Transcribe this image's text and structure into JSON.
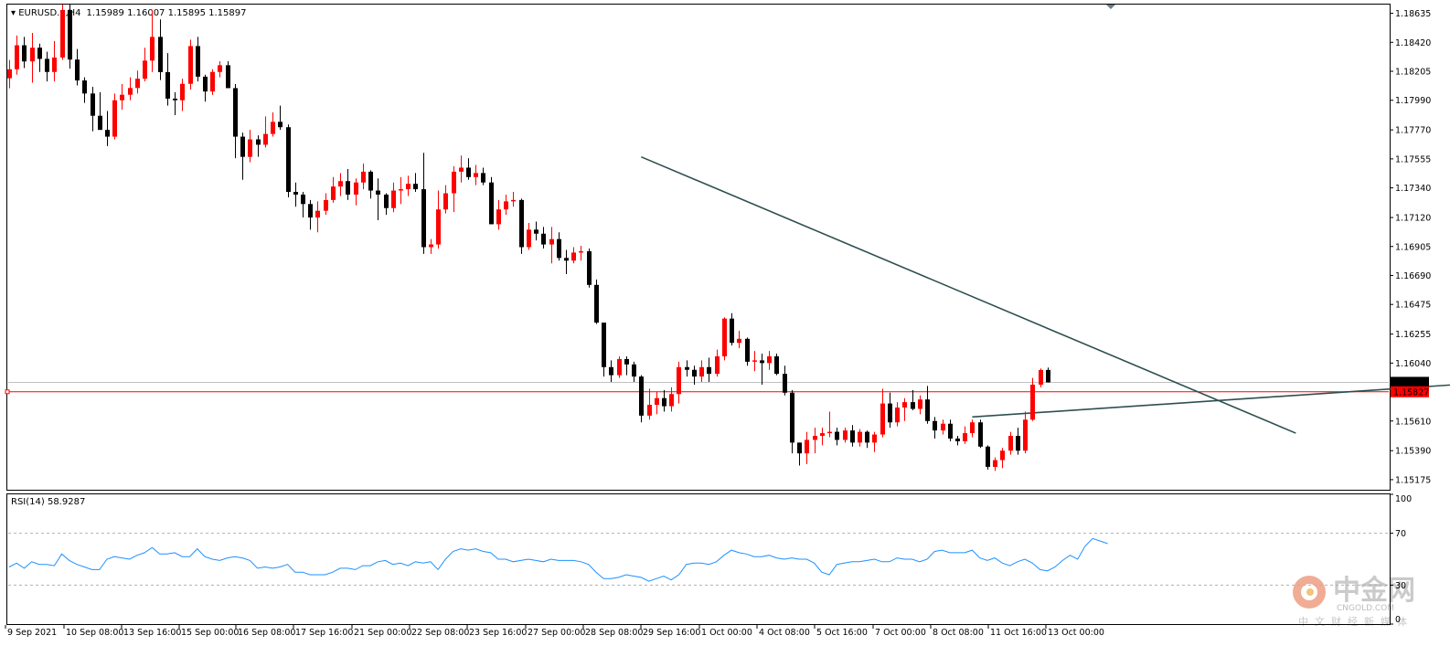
{
  "symbol_info": {
    "symbol": "EURUSD.a,H4",
    "ohlc": "1.15989 1.16007 1.15895 1.15897"
  },
  "price_axis": {
    "ticks": [
      "1.18635",
      "1.18420",
      "1.18205",
      "1.17990",
      "1.17770",
      "1.17555",
      "1.17340",
      "1.17120",
      "1.16905",
      "1.16690",
      "1.16475",
      "1.16255",
      "1.16040",
      "1.15610",
      "1.15390",
      "1.15175"
    ],
    "bid_label": "1.15897",
    "line_label": "1.15827"
  },
  "rsi_panel": {
    "label": "RSI(14) 58.9287",
    "levels": [
      "100",
      "70",
      "30",
      "0"
    ]
  },
  "time_axis": {
    "labels": [
      "9 Sep 2021",
      "10 Sep 08:00",
      "13 Sep 16:00",
      "15 Sep 00:00",
      "16 Sep 08:00",
      "17 Sep 16:00",
      "21 Sep 00:00",
      "22 Sep 08:00",
      "23 Sep 16:00",
      "27 Sep 00:00",
      "28 Sep 08:00",
      "29 Sep 16:00",
      "1 Oct 00:00",
      "4 Oct 08:00",
      "5 Oct 16:00",
      "7 Oct 00:00",
      "8 Oct 08:00",
      "11 Oct 16:00",
      "13 Oct 00:00"
    ]
  },
  "watermark": {
    "brand": "中金网",
    "domain": "CNGOLD.COM",
    "slogan": "中文财经新媒体"
  },
  "colors": {
    "bull": "#ff0000",
    "bear": "#000000",
    "rsi_line": "#1e90ff",
    "horizontal_line": "#ff0000",
    "trendline": "#2f4f4f",
    "bid_line": "#c0c0c0"
  },
  "chart_data": [
    {
      "type": "candlestick",
      "symbol": "EURUSD.a",
      "timeframe": "H4",
      "ylim": [
        1.151,
        1.187
      ],
      "horizontal_line": 1.15827,
      "bid": 1.15897,
      "trendlines": [
        {
          "from": [
            1.1757,
            84
          ],
          "to": [
            1.1552,
            171
          ]
        },
        {
          "from": [
            1.1564,
            128
          ],
          "to": [
            1.1592,
            203
          ]
        }
      ],
      "ohlc": [
        [
          1.18153,
          1.18289,
          1.18079,
          1.1822
        ],
        [
          1.1822,
          1.1847,
          1.1818,
          1.18398
        ],
        [
          1.18398,
          1.1846,
          1.18229,
          1.18278
        ],
        [
          1.18278,
          1.1849,
          1.1812,
          1.1838
        ],
        [
          1.1838,
          1.1841,
          1.182,
          1.18297
        ],
        [
          1.18297,
          1.1835,
          1.1813,
          1.182
        ],
        [
          1.182,
          1.1843,
          1.1813,
          1.18307
        ],
        [
          1.18307,
          1.187,
          1.1829,
          1.1866
        ],
        [
          1.1866,
          1.187,
          1.18225,
          1.18292
        ],
        [
          1.18292,
          1.1837,
          1.181,
          1.18137
        ],
        [
          1.18137,
          1.1816,
          1.1797,
          1.1804
        ],
        [
          1.1804,
          1.1809,
          1.1776,
          1.17875
        ],
        [
          1.17875,
          1.1805,
          1.1778,
          1.1777
        ],
        [
          1.1777,
          1.1791,
          1.1765,
          1.1772
        ],
        [
          1.1772,
          1.1804,
          1.177,
          1.1799
        ],
        [
          1.1799,
          1.1811,
          1.1792,
          1.18031
        ],
        [
          1.18031,
          1.1816,
          1.1799,
          1.18081
        ],
        [
          1.18081,
          1.1821,
          1.1804,
          1.1815
        ],
        [
          1.1815,
          1.1838,
          1.1813,
          1.18284
        ],
        [
          1.18284,
          1.1866,
          1.182,
          1.1846
        ],
        [
          1.1846,
          1.1859,
          1.1814,
          1.18199
        ],
        [
          1.18199,
          1.1834,
          1.1795,
          1.18002
        ],
        [
          1.18002,
          1.1805,
          1.1788,
          1.1799
        ],
        [
          1.1799,
          1.1815,
          1.1791,
          1.18112
        ],
        [
          1.18112,
          1.1844,
          1.1807,
          1.18392
        ],
        [
          1.18392,
          1.1846,
          1.1813,
          1.18165
        ],
        [
          1.18165,
          1.1818,
          1.1798,
          1.18055
        ],
        [
          1.18055,
          1.1822,
          1.1803,
          1.182
        ],
        [
          1.182,
          1.1828,
          1.1816,
          1.1825
        ],
        [
          1.1825,
          1.1828,
          1.1808,
          1.1808
        ],
        [
          1.1808,
          1.1811,
          1.1756,
          1.1772
        ],
        [
          1.1772,
          1.1775,
          1.174,
          1.1757
        ],
        [
          1.1757,
          1.1777,
          1.1753,
          1.177
        ],
        [
          1.177,
          1.1773,
          1.1757,
          1.1766
        ],
        [
          1.1766,
          1.1787,
          1.1764,
          1.1774
        ],
        [
          1.1774,
          1.179,
          1.1772,
          1.1783
        ],
        [
          1.1783,
          1.1795,
          1.1777,
          1.1779
        ],
        [
          1.1779,
          1.1781,
          1.1727,
          1.1731
        ],
        [
          1.1731,
          1.1738,
          1.172,
          1.1729
        ],
        [
          1.1729,
          1.1731,
          1.1712,
          1.1722
        ],
        [
          1.1722,
          1.1725,
          1.1703,
          1.1712
        ],
        [
          1.1712,
          1.1724,
          1.1701,
          1.1717
        ],
        [
          1.1717,
          1.173,
          1.1714,
          1.1725
        ],
        [
          1.1725,
          1.1742,
          1.1723,
          1.1735
        ],
        [
          1.1735,
          1.1745,
          1.1728,
          1.1739
        ],
        [
          1.1739,
          1.1748,
          1.1725,
          1.1729
        ],
        [
          1.1729,
          1.1741,
          1.1721,
          1.1738
        ],
        [
          1.1738,
          1.1752,
          1.1733,
          1.1746
        ],
        [
          1.1746,
          1.1747,
          1.1726,
          1.1732
        ],
        [
          1.1732,
          1.1741,
          1.171,
          1.1729
        ],
        [
          1.1729,
          1.173,
          1.1714,
          1.1719
        ],
        [
          1.1719,
          1.1738,
          1.1716,
          1.1732
        ],
        [
          1.1732,
          1.1742,
          1.1722,
          1.1733
        ],
        [
          1.1733,
          1.1743,
          1.1728,
          1.1737
        ],
        [
          1.1737,
          1.1745,
          1.1731,
          1.1733
        ],
        [
          1.1733,
          1.176,
          1.1685,
          1.169
        ],
        [
          1.169,
          1.1696,
          1.1685,
          1.1692
        ],
        [
          1.1692,
          1.1732,
          1.1689,
          1.1718
        ],
        [
          1.1718,
          1.1736,
          1.1715,
          1.173
        ],
        [
          1.173,
          1.175,
          1.1716,
          1.1746
        ],
        [
          1.1746,
          1.1758,
          1.1738,
          1.1749
        ],
        [
          1.1749,
          1.1756,
          1.174,
          1.1742
        ],
        [
          1.1742,
          1.1751,
          1.1736,
          1.1745
        ],
        [
          1.1745,
          1.1749,
          1.1736,
          1.1738
        ],
        [
          1.1738,
          1.1742,
          1.1707,
          1.1707
        ],
        [
          1.1707,
          1.1725,
          1.1703,
          1.1718
        ],
        [
          1.1718,
          1.1729,
          1.1714,
          1.1724
        ],
        [
          1.1724,
          1.1731,
          1.172,
          1.1725
        ],
        [
          1.1725,
          1.1726,
          1.1685,
          1.169
        ],
        [
          1.169,
          1.1708,
          1.1688,
          1.1703
        ],
        [
          1.1703,
          1.1709,
          1.1695,
          1.17
        ],
        [
          1.17,
          1.1705,
          1.1689,
          1.1692
        ],
        [
          1.1692,
          1.1705,
          1.1678,
          1.1696
        ],
        [
          1.1696,
          1.1701,
          1.168,
          1.1682
        ],
        [
          1.1682,
          1.1688,
          1.167,
          1.168
        ],
        [
          1.168,
          1.169,
          1.1678,
          1.1686
        ],
        [
          1.1686,
          1.1691,
          1.168,
          1.1687
        ],
        [
          1.1687,
          1.1689,
          1.166,
          1.1662
        ],
        [
          1.1662,
          1.1666,
          1.1633,
          1.1634
        ],
        [
          1.1634,
          1.1634,
          1.1594,
          1.1601
        ],
        [
          1.1601,
          1.1606,
          1.159,
          1.1595
        ],
        [
          1.1595,
          1.1609,
          1.1593,
          1.1607
        ],
        [
          1.1607,
          1.1609,
          1.1595,
          1.1603
        ],
        [
          1.1603,
          1.1605,
          1.159,
          1.1594
        ],
        [
          1.1594,
          1.1595,
          1.156,
          1.1565
        ],
        [
          1.1565,
          1.1585,
          1.1562,
          1.1573
        ],
        [
          1.1573,
          1.1583,
          1.1566,
          1.1578
        ],
        [
          1.1578,
          1.1584,
          1.1568,
          1.1572
        ],
        [
          1.1572,
          1.1586,
          1.1568,
          1.1581
        ],
        [
          1.1581,
          1.1605,
          1.1574,
          1.1601
        ],
        [
          1.1601,
          1.1606,
          1.1594,
          1.1599
        ],
        [
          1.1599,
          1.1602,
          1.1588,
          1.1594
        ],
        [
          1.1594,
          1.1606,
          1.159,
          1.1601
        ],
        [
          1.1601,
          1.1608,
          1.159,
          1.1596
        ],
        [
          1.1596,
          1.1614,
          1.1594,
          1.1609
        ],
        [
          1.1609,
          1.1638,
          1.1606,
          1.1637
        ],
        [
          1.1637,
          1.1641,
          1.1617,
          1.1619
        ],
        [
          1.1619,
          1.1628,
          1.1615,
          1.1622
        ],
        [
          1.1622,
          1.1623,
          1.1602,
          1.1605
        ],
        [
          1.1605,
          1.1613,
          1.1598,
          1.1606
        ],
        [
          1.1606,
          1.1611,
          1.1588,
          1.1604
        ],
        [
          1.1604,
          1.1613,
          1.1599,
          1.1609
        ],
        [
          1.1609,
          1.1611,
          1.1595,
          1.1596
        ],
        [
          1.1596,
          1.1602,
          1.158,
          1.1582
        ],
        [
          1.1582,
          1.1584,
          1.1537,
          1.1545
        ],
        [
          1.1545,
          1.1545,
          1.1528,
          1.1537
        ],
        [
          1.1537,
          1.1553,
          1.1529,
          1.1547
        ],
        [
          1.1547,
          1.1556,
          1.1537,
          1.155
        ],
        [
          1.155,
          1.1556,
          1.1543,
          1.1552
        ],
        [
          1.1552,
          1.1568,
          1.1549,
          1.1553
        ],
        [
          1.1553,
          1.1556,
          1.1543,
          1.1547
        ],
        [
          1.1547,
          1.1556,
          1.1545,
          1.1554
        ],
        [
          1.1554,
          1.1558,
          1.1542,
          1.1545
        ],
        [
          1.1545,
          1.1555,
          1.1542,
          1.1553
        ],
        [
          1.1553,
          1.1554,
          1.1541,
          1.1545
        ],
        [
          1.1545,
          1.1553,
          1.1538,
          1.1551
        ],
        [
          1.1551,
          1.1585,
          1.1549,
          1.1574
        ],
        [
          1.1574,
          1.1582,
          1.1556,
          1.156
        ],
        [
          1.156,
          1.1575,
          1.1557,
          1.1571
        ],
        [
          1.1571,
          1.1578,
          1.1561,
          1.1575
        ],
        [
          1.1575,
          1.1584,
          1.1569,
          1.157
        ],
        [
          1.157,
          1.158,
          1.1566,
          1.1577
        ],
        [
          1.1577,
          1.1587,
          1.1559,
          1.1561
        ],
        [
          1.1561,
          1.1564,
          1.1548,
          1.1554
        ],
        [
          1.1554,
          1.1562,
          1.1551,
          1.1559
        ],
        [
          1.1559,
          1.1562,
          1.1546,
          1.1548
        ],
        [
          1.1548,
          1.155,
          1.1543,
          1.1546
        ],
        [
          1.1546,
          1.1557,
          1.1544,
          1.1552
        ],
        [
          1.1552,
          1.1562,
          1.1549,
          1.156
        ],
        [
          1.156,
          1.1562,
          1.1541,
          1.1542
        ],
        [
          1.1542,
          1.1543,
          1.1525,
          1.1527
        ],
        [
          1.1527,
          1.1534,
          1.1524,
          1.1532
        ],
        [
          1.1532,
          1.1541,
          1.1526,
          1.1539
        ],
        [
          1.1539,
          1.1553,
          1.1536,
          1.155
        ],
        [
          1.155,
          1.1556,
          1.1536,
          1.1539
        ],
        [
          1.1539,
          1.1568,
          1.1537,
          1.1562
        ],
        [
          1.1562,
          1.1593,
          1.1561,
          1.1588
        ],
        [
          1.1588,
          1.16,
          1.1586,
          1.15989
        ],
        [
          1.15989,
          1.16007,
          1.15895,
          1.15897
        ]
      ],
      "rsi": [
        44,
        47,
        43,
        48,
        46,
        46,
        45,
        54,
        49,
        46,
        44,
        42,
        42,
        50,
        52,
        51,
        50,
        53,
        55,
        59,
        54,
        54,
        55,
        52,
        52,
        58,
        52,
        50,
        49,
        51,
        52,
        51,
        49,
        43,
        44,
        43,
        44,
        46,
        40,
        40,
        38,
        38,
        38,
        40,
        43,
        43,
        42,
        45,
        45,
        48,
        49,
        46,
        47,
        45,
        48,
        47,
        48,
        42,
        50,
        56,
        58,
        57,
        58,
        56,
        55,
        50,
        50,
        48,
        49,
        50,
        49,
        48,
        50,
        49,
        49,
        49,
        48,
        46,
        40,
        35,
        35,
        36,
        38,
        37,
        36,
        33,
        35,
        37,
        34,
        38,
        46,
        47,
        47,
        46,
        48,
        53,
        57,
        55,
        54,
        52,
        52,
        53,
        51,
        50,
        51,
        50,
        50,
        47,
        40,
        38,
        46,
        47,
        48,
        48,
        49,
        50,
        48,
        48,
        51,
        50,
        50,
        48,
        50,
        56,
        57,
        55,
        55,
        55,
        57,
        51,
        49,
        51,
        47,
        45,
        48,
        50,
        47,
        42,
        41,
        44,
        49,
        53,
        50,
        60,
        66,
        64,
        62
      ]
    }
  ]
}
